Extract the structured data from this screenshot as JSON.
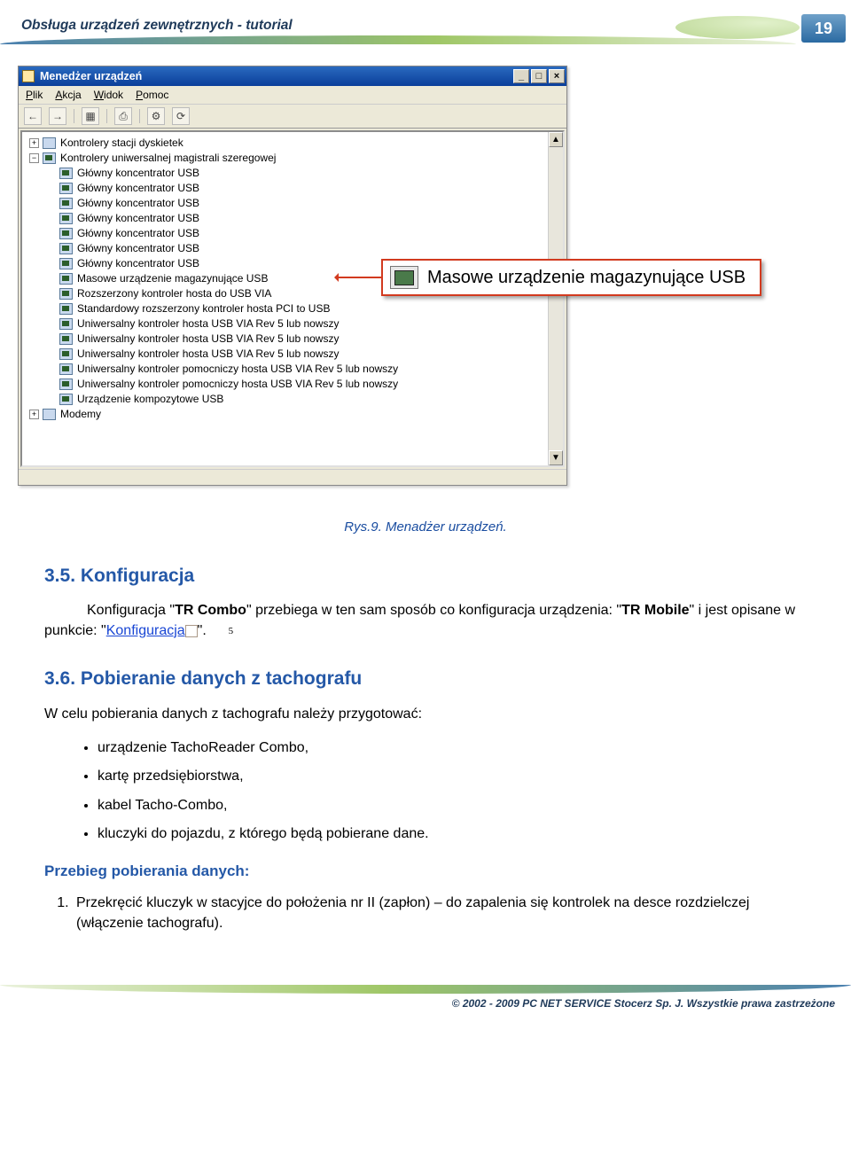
{
  "header": {
    "title": "Obsługa urządzeń zewnętrznych - tutorial",
    "page_number": "19"
  },
  "devmgr": {
    "window_title": "Menedżer urządzeń",
    "menu": {
      "plik": "Plik",
      "akcja": "Akcja",
      "widok": "Widok",
      "pomoc": "Pomoc"
    },
    "win_btn": {
      "min": "_",
      "max": "□",
      "close": "×"
    },
    "collapsed_top": {
      "exp": "+",
      "label": "Kontrolery stacji dyskietek"
    },
    "expanded_cat": {
      "exp": "−",
      "label": "Kontrolery uniwersalnej magistrali szeregowej"
    },
    "items": [
      "Główny koncentrator USB",
      "Główny koncentrator USB",
      "Główny koncentrator USB",
      "Główny koncentrator USB",
      "Główny koncentrator USB",
      "Główny koncentrator USB",
      "Główny koncentrator USB",
      "Masowe urządzenie magazynujące USB",
      "Rozszerzony kontroler hosta do USB VIA",
      "Standardowy rozszerzony kontroler hosta PCI to USB",
      "Uniwersalny kontroler hosta USB VIA Rev 5 lub nowszy",
      "Uniwersalny kontroler hosta USB VIA Rev 5 lub nowszy",
      "Uniwersalny kontroler hosta USB VIA Rev 5 lub nowszy",
      "Uniwersalny kontroler pomocniczy hosta USB VIA Rev 5 lub nowszy",
      "Uniwersalny kontroler pomocniczy hosta USB VIA Rev 5 lub nowszy",
      "Urządzenie kompozytowe USB"
    ],
    "collapsed_bottom": {
      "exp": "+",
      "label": "Modemy"
    },
    "scroll": {
      "up": "▲",
      "down": "▼"
    }
  },
  "callout": {
    "text": "Masowe urządzenie magazynujące USB"
  },
  "figure_caption": "Rys.9. Menadżer urządzeń.",
  "sec35": {
    "heading": "3.5. Konfiguracja",
    "p_pre": "Konfiguracja \"",
    "p_b1": "TR Combo",
    "p_mid": "\" przebiega w ten sam sposób co konfiguracja urządzenia: \"",
    "p_b2": "TR Mobile",
    "p_aft": "\" i jest opisane w punkcie: \"",
    "link": "Konfiguracja",
    "refnum": "5",
    "p_end": "\"."
  },
  "sec36": {
    "heading": "3.6. Pobieranie danych z tachografu",
    "intro": "W celu pobierania danych z tachografu należy przygotować:",
    "items": [
      "urządzenie TachoReader Combo,",
      "kartę przedsiębiorstwa,",
      "kabel Tacho-Combo,",
      "kluczyki do pojazdu, z którego będą pobierane dane."
    ],
    "sub_heading": "Przebieg pobierania danych:",
    "step1": "Przekręcić kluczyk w stacyjce do położenia nr II (zapłon) – do zapalenia się kontrolek na desce rozdzielczej (włączenie tachografu)."
  },
  "footer": {
    "copyright": "© 2002 - 2009 PC NET SERVICE Stocerz Sp. J. Wszystkie prawa zastrzeżone"
  }
}
